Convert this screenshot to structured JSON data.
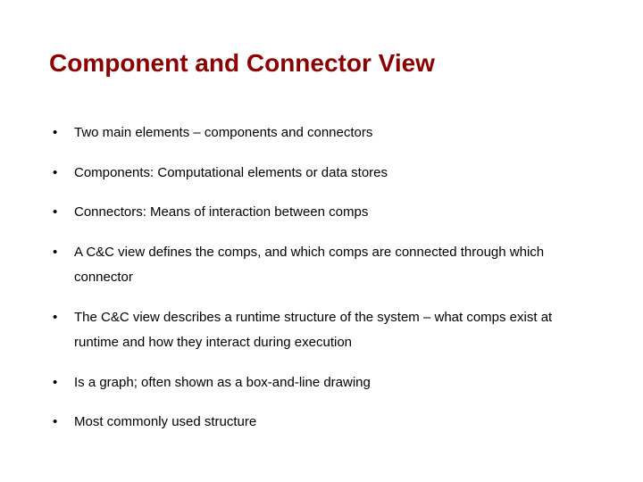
{
  "slide": {
    "title": "Component and Connector View",
    "bullets": [
      "Two main elements – components and connectors",
      "Components: Computational elements or data stores",
      "Connectors: Means of interaction between comps",
      "A C&C view defines the comps, and which comps are connected through which connector",
      "The C&C view describes a runtime structure of the system – what comps exist at runtime and how they interact during execution",
      "Is a graph; often shown as a box-and-line drawing",
      "Most commonly used structure"
    ]
  }
}
